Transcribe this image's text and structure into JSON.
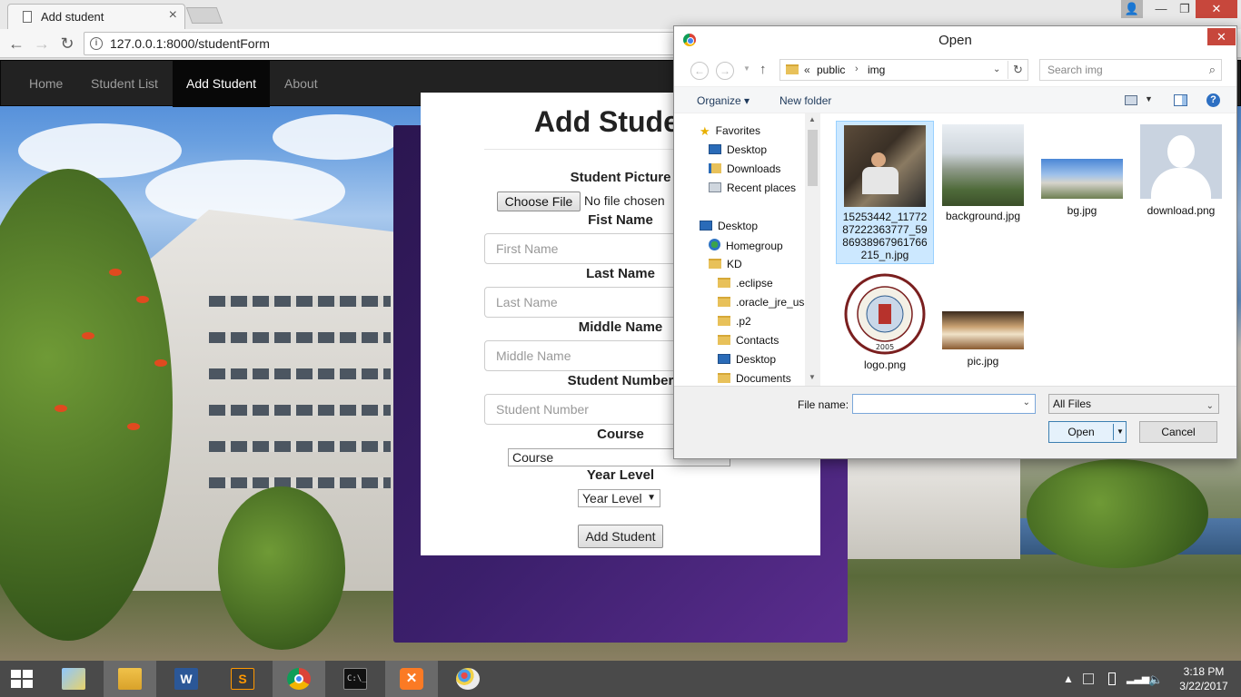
{
  "browser": {
    "tab_title": "Add student",
    "tab_close": "×",
    "url": "127.0.0.1:8000/studentForm",
    "back": "←",
    "forward": "→",
    "reload": "↻",
    "window": {
      "minimize": "—",
      "maximize": "❐",
      "close": "✕"
    }
  },
  "navbar": {
    "items": [
      {
        "label": "Home",
        "active": false
      },
      {
        "label": "Student List",
        "active": false
      },
      {
        "label": "Add Student",
        "active": true
      },
      {
        "label": "About",
        "active": false
      }
    ]
  },
  "form": {
    "title": "Add Student",
    "picture_label": "Student Picture",
    "choose_file": "Choose File",
    "file_status": "No file chosen",
    "first_name_label": "Fist Name",
    "first_name_placeholder": "First Name",
    "last_name_label": "Last Name",
    "last_name_placeholder": "Last Name",
    "middle_name_label": "Middle Name",
    "middle_name_placeholder": "Middle Name",
    "student_number_label": "Student Number",
    "student_number_placeholder": "Student Number",
    "course_label": "Course",
    "course_value": "Course",
    "year_level_label": "Year Level",
    "year_level_value": "Year Level",
    "submit": "Add Student"
  },
  "dialog": {
    "title": "Open",
    "close": "✕",
    "path": [
      "«",
      "public",
      "›",
      "img"
    ],
    "search_placeholder": "Search img",
    "organize": "Organize ▾",
    "new_folder": "New folder",
    "tree": [
      {
        "label": "Favorites",
        "icon": "star-icon"
      },
      {
        "label": "Desktop",
        "icon": "desktop-icon"
      },
      {
        "label": "Downloads",
        "icon": "downloads-icon"
      },
      {
        "label": "Recent places",
        "icon": "recent-places-icon"
      },
      {
        "label": "Desktop",
        "icon": "desktop-icon"
      },
      {
        "label": "Homegroup",
        "icon": "homegroup-icon"
      },
      {
        "label": "KD",
        "icon": "user-folder-icon"
      },
      {
        "label": ".eclipse",
        "icon": "folder-icon"
      },
      {
        "label": ".oracle_jre_usa",
        "icon": "folder-icon"
      },
      {
        "label": ".p2",
        "icon": "folder-icon"
      },
      {
        "label": "Contacts",
        "icon": "contacts-icon"
      },
      {
        "label": "Desktop",
        "icon": "desktop-icon"
      },
      {
        "label": "Documents",
        "icon": "documents-icon"
      }
    ],
    "files": [
      {
        "name": "15253442_1177287222363777_5986938967961766215_n.jpg",
        "selected": true
      },
      {
        "name": "background.jpg",
        "selected": false
      },
      {
        "name": "bg.jpg",
        "selected": false
      },
      {
        "name": "download.png",
        "selected": false
      },
      {
        "name": "logo.png",
        "selected": false
      },
      {
        "name": "pic.jpg",
        "selected": false
      }
    ],
    "logo_text": "LA VERDAD CHRISTIAN COLLEGE",
    "logo_year": "2005",
    "file_name_label": "File name:",
    "file_name_value": "",
    "file_type": "All Files",
    "open": "Open",
    "cancel": "Cancel"
  },
  "taskbar": {
    "apps": [
      "file-explorer",
      "file-manager",
      "word",
      "sublime-text",
      "chrome",
      "command-prompt",
      "xampp",
      "paint"
    ],
    "time": "3:18 PM",
    "date": "3/22/2017"
  },
  "colors": {
    "navbar_bg": "#222222",
    "card_purple": "#3b1f6b",
    "dialog_close": "#c7473c",
    "selection": "#cce8ff"
  }
}
